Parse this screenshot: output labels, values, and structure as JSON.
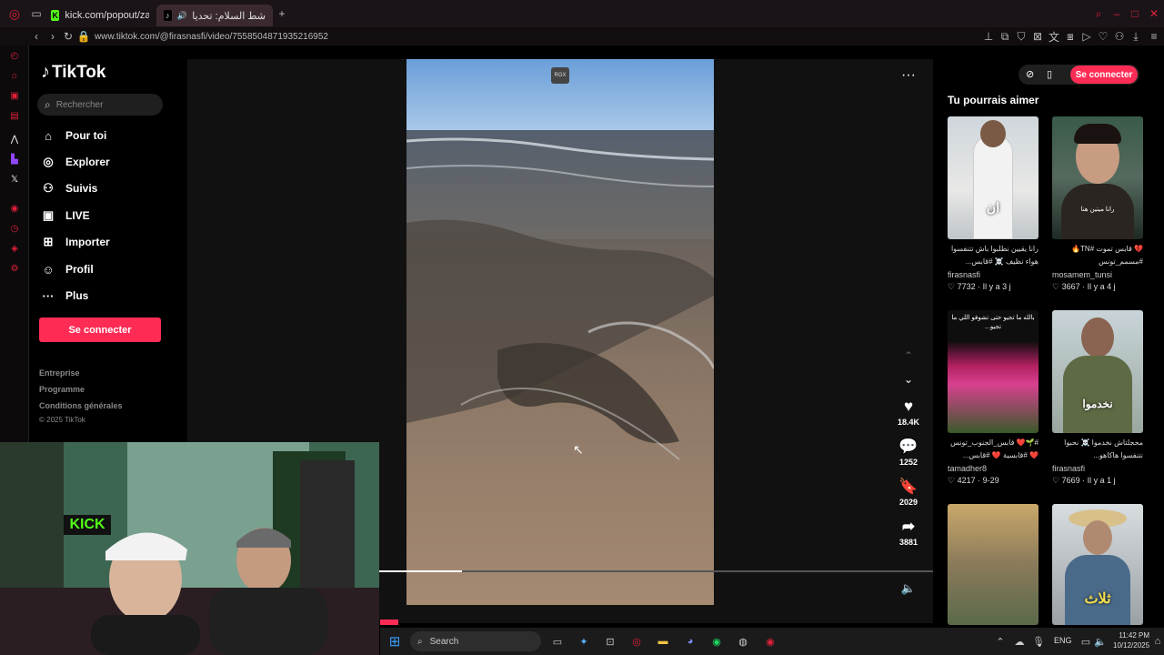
{
  "browser": {
    "tabs": [
      {
        "title": "kick.com/popout/zanoun"
      },
      {
        "title": "شط السلام: تحديات التلو"
      }
    ],
    "url": "www.tiktok.com/@firasnasfi/video/7558504871935216952"
  },
  "tiktok": {
    "logo": "TikTok",
    "search_placeholder": "Rechercher",
    "nav": [
      {
        "label": "Pour toi",
        "icon": "home-icon"
      },
      {
        "label": "Explorer",
        "icon": "compass-icon"
      },
      {
        "label": "Suivis",
        "icon": "following-icon"
      },
      {
        "label": "LIVE",
        "icon": "live-icon"
      },
      {
        "label": "Importer",
        "icon": "upload-icon"
      },
      {
        "label": "Profil",
        "icon": "profile-icon"
      },
      {
        "label": "Plus",
        "icon": "more-icon"
      }
    ],
    "login_label": "Se connecter",
    "footer_links": [
      "Entreprise",
      "Programme",
      "Conditions générales"
    ],
    "copyright": "© 2025 TikTok"
  },
  "video": {
    "watermark": "RGX",
    "progress": 0.15,
    "actions": {
      "likes": "18.4K",
      "comments": "1252",
      "saves": "2029",
      "shares": "3881"
    }
  },
  "recommendations": {
    "title": "Tu pourrais aimer",
    "login_label": "Se connecter",
    "items": [
      {
        "caption": "رانا يقيين نطلبوا باش تتنفسوا هواء نظيف ☠️ #قابس...",
        "author": "firasnasfi",
        "likes": "7732",
        "age": "Il y a 3 j",
        "thumb_text": "ان"
      },
      {
        "caption": "💔 قابس تموت #TN🔥 #مسمم_تونس",
        "author": "mosamem_tunsi",
        "likes": "3667",
        "age": "Il y a 4 j",
        "thumb_text": "رانا ميتين هنا"
      },
      {
        "caption": "#🌱❤️ قابس_الجنوب_تونس ❤️ #قابسية ❤️ #قابس...",
        "author": "tamadher8",
        "likes": "4217",
        "age": "9-29",
        "thumb_text": "بالله ما تجيو حتى تشوفو اللي ما تجيو..."
      },
      {
        "caption": "محجلتاش نخدموا ☠️ نحبوا نتنفسوا هاكاهو...",
        "author": "firasnasfi",
        "likes": "7669",
        "age": "Il y a 1 j",
        "thumb_text": "نخدموا"
      },
      {
        "caption": "",
        "author": "",
        "likes": "",
        "age": "",
        "thumb_text": ""
      },
      {
        "caption": "",
        "author": "",
        "likes": "",
        "age": "",
        "thumb_text": "ثلاث"
      }
    ]
  },
  "webcam": {
    "sign": "KICK"
  },
  "taskbar": {
    "search_label": "Search",
    "lang": "ENG",
    "time": "11:42 PM",
    "date": "10/12/2025"
  },
  "colors": {
    "accent": "#fe2c55"
  }
}
